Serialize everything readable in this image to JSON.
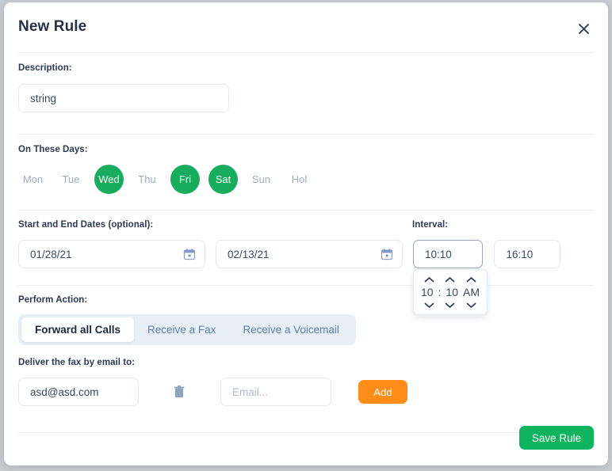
{
  "dialog": {
    "title": "New Rule",
    "close_icon": "close-icon"
  },
  "description": {
    "label": "Description:",
    "value": "string",
    "placeholder": ""
  },
  "days": {
    "label": "On These Days:",
    "items": [
      {
        "label": "Mon",
        "selected": false
      },
      {
        "label": "Tue",
        "selected": false
      },
      {
        "label": "Wed",
        "selected": true
      },
      {
        "label": "Thu",
        "selected": false
      },
      {
        "label": "Fri",
        "selected": true
      },
      {
        "label": "Sat",
        "selected": true
      },
      {
        "label": "Sun",
        "selected": false
      },
      {
        "label": "Hol",
        "selected": false
      }
    ]
  },
  "dates": {
    "label": "Start and End Dates (optional):",
    "start_value": "01/28/21",
    "end_value": "02/13/21",
    "calendar_icon": "calendar-icon"
  },
  "interval": {
    "label": "Interval:",
    "start_value": "10:10",
    "end_value": "16:10",
    "picker": {
      "hour": "10",
      "separator": ":",
      "minute": "10",
      "meridiem": "AM"
    }
  },
  "action": {
    "label": "Perform Action:",
    "tabs": [
      {
        "label": "Forward all Calls",
        "active": true
      },
      {
        "label": "Receive a Fax",
        "active": false
      },
      {
        "label": "Receive a Voicemail",
        "active": false
      }
    ]
  },
  "email": {
    "label": "Deliver the fax by email to:",
    "existing_value": "asd@asd.com",
    "new_placeholder": "Email...",
    "new_value": "",
    "add_label": "Add",
    "delete_icon": "trash-icon"
  },
  "footer": {
    "save_label": "Save Rule"
  },
  "colors": {
    "green": "#17ad5c",
    "save_green": "#0fb55e",
    "orange": "#ff8c17",
    "tab_track": "#e8eef6",
    "tab_inactive_text": "#5d82ab",
    "calendar_blue": "#7f98c4",
    "border": "#e4e9f0"
  }
}
